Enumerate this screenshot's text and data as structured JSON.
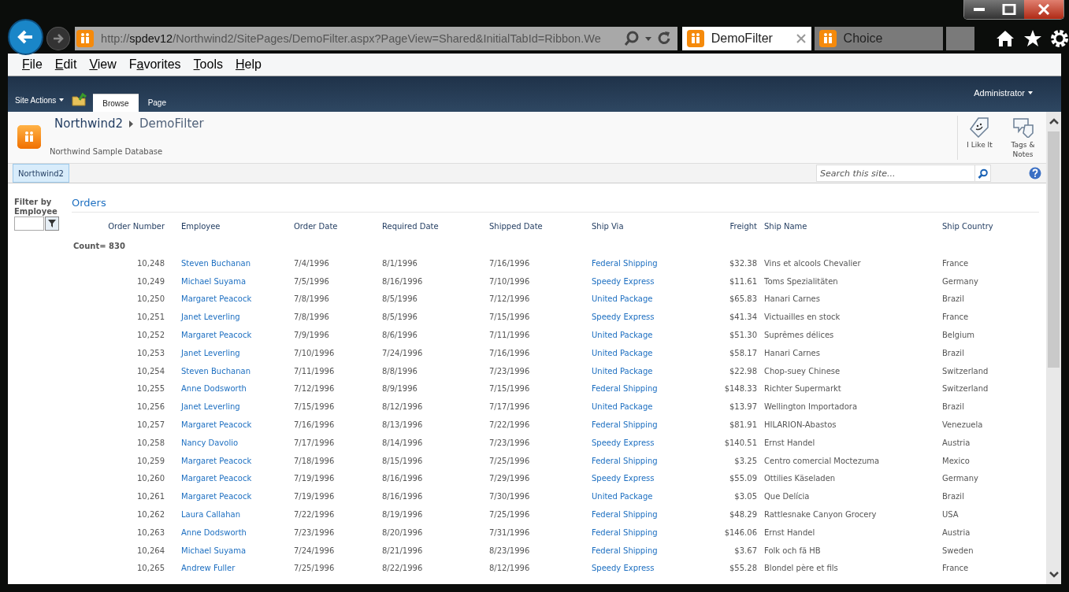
{
  "browser": {
    "address": {
      "scheme": "http://",
      "host": "spdev12",
      "path": "/Northwind2/SitePages/DemoFilter.aspx?PageView=Shared&InitialTabId=Ribbon.We"
    },
    "tabs": [
      {
        "label": "DemoFilter",
        "selected": true
      },
      {
        "label": "Choice",
        "selected": false
      }
    ],
    "menu": [
      {
        "access_key": "F",
        "rest": "ile"
      },
      {
        "access_key": "E",
        "rest": "dit"
      },
      {
        "access_key": "V",
        "rest": "iew"
      },
      {
        "before": "F",
        "access_key": "a",
        "rest": "vorites"
      },
      {
        "access_key": "T",
        "rest": "ools"
      },
      {
        "access_key": "H",
        "rest": "elp"
      }
    ]
  },
  "ribbon": {
    "site_actions": "Site Actions",
    "tabs": [
      {
        "label": "Browse",
        "selected": true
      },
      {
        "label": "Page",
        "selected": false
      }
    ],
    "user": "Administrator"
  },
  "header": {
    "breadcrumb": [
      "Northwind2",
      "DemoFilter"
    ],
    "description": "Northwind Sample Database",
    "social": [
      {
        "kind": "like",
        "label": "I Like It"
      },
      {
        "kind": "tags",
        "label": "Tags & Notes"
      }
    ]
  },
  "nav": {
    "items": [
      {
        "label": "Northwind2",
        "selected": true
      }
    ],
    "search": {
      "placeholder": "Search this site..."
    }
  },
  "filter": {
    "label": "Filter by Employee"
  },
  "webpart": {
    "title": "Orders",
    "count": "Count= 830",
    "table": {
      "columns": [
        {
          "label": "Order Number",
          "kind": "number"
        },
        {
          "label": "Employee",
          "kind": "link"
        },
        {
          "label": "Order Date",
          "kind": "text"
        },
        {
          "label": "Required Date",
          "kind": "text"
        },
        {
          "label": "Shipped Date",
          "kind": "text"
        },
        {
          "label": "Ship Via",
          "kind": "link"
        },
        {
          "label": "Freight",
          "kind": "number"
        },
        {
          "label": "Ship Name",
          "kind": "text"
        },
        {
          "label": "Ship Country",
          "kind": "text"
        }
      ],
      "rows": [
        [
          "10,248",
          "Steven Buchanan",
          "7/4/1996",
          "8/1/1996",
          "7/16/1996",
          "Federal Shipping",
          "$32.38",
          "Vins et alcools Chevalier",
          "France"
        ],
        [
          "10,249",
          "Michael Suyama",
          "7/5/1996",
          "8/16/1996",
          "7/10/1996",
          "Speedy Express",
          "$11.61",
          "Toms Spezialitäten",
          "Germany"
        ],
        [
          "10,250",
          "Margaret Peacock",
          "7/8/1996",
          "8/5/1996",
          "7/12/1996",
          "United Package",
          "$65.83",
          "Hanari Carnes",
          "Brazil"
        ],
        [
          "10,251",
          "Janet Leverling",
          "7/8/1996",
          "8/5/1996",
          "7/15/1996",
          "Speedy Express",
          "$41.34",
          "Victuailles en stock",
          "France"
        ],
        [
          "10,252",
          "Margaret Peacock",
          "7/9/1996",
          "8/6/1996",
          "7/11/1996",
          "United Package",
          "$51.30",
          "Suprêmes délices",
          "Belgium"
        ],
        [
          "10,253",
          "Janet Leverling",
          "7/10/1996",
          "7/24/1996",
          "7/16/1996",
          "United Package",
          "$58.17",
          "Hanari Carnes",
          "Brazil"
        ],
        [
          "10,254",
          "Steven Buchanan",
          "7/11/1996",
          "8/8/1996",
          "7/23/1996",
          "United Package",
          "$22.98",
          "Chop-suey Chinese",
          "Switzerland"
        ],
        [
          "10,255",
          "Anne Dodsworth",
          "7/12/1996",
          "8/9/1996",
          "7/15/1996",
          "Federal Shipping",
          "$148.33",
          "Richter Supermarkt",
          "Switzerland"
        ],
        [
          "10,256",
          "Janet Leverling",
          "7/15/1996",
          "8/12/1996",
          "7/17/1996",
          "United Package",
          "$13.97",
          "Wellington Importadora",
          "Brazil"
        ],
        [
          "10,257",
          "Margaret Peacock",
          "7/16/1996",
          "8/13/1996",
          "7/22/1996",
          "Federal Shipping",
          "$81.91",
          "HILARION-Abastos",
          "Venezuela"
        ],
        [
          "10,258",
          "Nancy Davolio",
          "7/17/1996",
          "8/14/1996",
          "7/23/1996",
          "Speedy Express",
          "$140.51",
          "Ernst Handel",
          "Austria"
        ],
        [
          "10,259",
          "Margaret Peacock",
          "7/18/1996",
          "8/15/1996",
          "7/25/1996",
          "Federal Shipping",
          "$3.25",
          "Centro comercial Moctezuma",
          "Mexico"
        ],
        [
          "10,260",
          "Margaret Peacock",
          "7/19/1996",
          "8/16/1996",
          "7/29/1996",
          "Speedy Express",
          "$55.09",
          "Ottilies Käseladen",
          "Germany"
        ],
        [
          "10,261",
          "Margaret Peacock",
          "7/19/1996",
          "8/16/1996",
          "7/30/1996",
          "United Package",
          "$3.05",
          "Que Delícia",
          "Brazil"
        ],
        [
          "10,262",
          "Laura Callahan",
          "7/22/1996",
          "8/19/1996",
          "7/25/1996",
          "Federal Shipping",
          "$48.29",
          "Rattlesnake Canyon Grocery",
          "USA"
        ],
        [
          "10,263",
          "Anne Dodsworth",
          "7/23/1996",
          "8/20/1996",
          "7/31/1996",
          "Federal Shipping",
          "$146.06",
          "Ernst Handel",
          "Austria"
        ],
        [
          "10,264",
          "Michael Suyama",
          "7/24/1996",
          "8/21/1996",
          "8/23/1996",
          "Federal Shipping",
          "$3.67",
          "Folk och fä HB",
          "Sweden"
        ],
        [
          "10,265",
          "Andrew Fuller",
          "7/25/1996",
          "8/22/1996",
          "8/12/1996",
          "Speedy Express",
          "$55.28",
          "Blondel père et fils",
          "France"
        ]
      ]
    }
  }
}
